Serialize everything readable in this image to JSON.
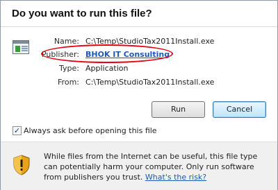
{
  "dialog": {
    "title": "Do you want to run this file?"
  },
  "file": {
    "icon": "application-file-icon",
    "name_label": "Name:",
    "name_value": "C:\\Temp\\StudioTax2011Install.exe",
    "publisher_label": "Publisher:",
    "publisher_value": "BHOK IT Consulting",
    "type_label": "Type:",
    "type_value": "Application",
    "from_label": "From:",
    "from_value": "C:\\Temp\\StudioTax2011Install.exe"
  },
  "buttons": {
    "run": "Run",
    "cancel": "Cancel"
  },
  "checkbox": {
    "label": "Always ask before opening this file",
    "checked": true,
    "mark": "✓"
  },
  "footer": {
    "icon": "security-warning-shield-icon",
    "warning": "While files from the Internet can be useful, this file type can potentially harm your computer. Only run software from publishers you trust.",
    "link": "What's the risk?"
  },
  "colors": {
    "link": "#1a59b6",
    "highlight": "#e60012",
    "footer_bg": "#f0f0f0"
  }
}
